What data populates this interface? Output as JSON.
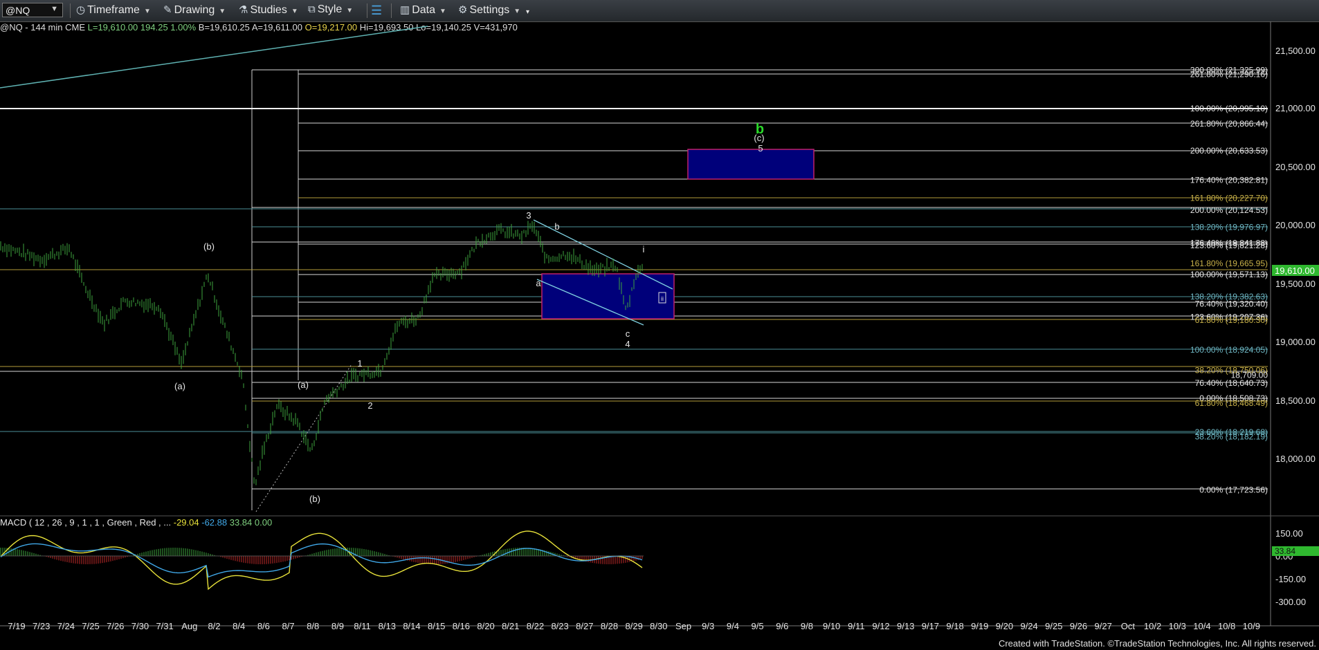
{
  "toolbar": {
    "symbol": "@NQ",
    "timeframe": "Timeframe",
    "drawing": "Drawing",
    "studies": "Studies",
    "style": "Style",
    "data": "Data",
    "settings": "Settings"
  },
  "info_bar": {
    "symbol_desc": "@NQ - 144 min  CME",
    "last": "L=19,610.00",
    "change": "194.25",
    "change_pct": "1.00%",
    "bid": "B=19,610.25",
    "ask": "A=19,611.00",
    "open": "O=19,217.00",
    "high": "Hi=19,693.50",
    "low": "Lo=19,140.25",
    "volume": "V=431,970"
  },
  "price_axis": {
    "labels": [
      "21,500.00",
      "21,000.00",
      "20,500.00",
      "20,000.00",
      "19,500.00",
      "19,000.00",
      "18,500.00",
      "18,000.00"
    ],
    "last_price_tag": "19,610.00",
    "last_price_color": "#2fb82f"
  },
  "fib_labels": [
    {
      "text": "300.00% (21,325.99)",
      "color": "#e6e6e6"
    },
    {
      "text": "261.80% (21,290.16)",
      "color": "#e6e6e6"
    },
    {
      "text": "100.00% (20,995.10)",
      "color": "#e6e6e6"
    },
    {
      "text": "261.80% (20,866.44)",
      "color": "#e6e6e6"
    },
    {
      "text": "200.00% (20,633.53)",
      "color": "#e6e6e6"
    },
    {
      "text": "176.40% (20,382.81)",
      "color": "#e6e6e6"
    },
    {
      "text": "161.80% (20,227.70)",
      "color": "#c9b24a"
    },
    {
      "text": "200.00% (20,124.53)",
      "color": "#e6e6e6"
    },
    {
      "text": "138.20% (19,976.97)",
      "color": "#6fb7c4"
    },
    {
      "text": "176.40% (19,841.88)",
      "color": "#e6e6e6"
    },
    {
      "text": "123.60% (19,821.28)",
      "color": "#e6e6e6"
    },
    {
      "text": "161.80% (19,665.95)",
      "color": "#c9b24a"
    },
    {
      "text": "100.00% (19,571.13)",
      "color": "#e6e6e6"
    },
    {
      "text": "138.20% (19,382.63)",
      "color": "#6fb7c4"
    },
    {
      "text": "76.40% (19,320.40)",
      "color": "#e6e6e6"
    },
    {
      "text": "123.60% (19,207.36)",
      "color": "#e6e6e6"
    },
    {
      "text": "61.80% (19,180.30)",
      "color": "#c9b24a"
    },
    {
      "text": "100.00% (18,924.05)",
      "color": "#6fb7c4"
    },
    {
      "text": "38.20% (18,750.06)",
      "color": "#c9b24a"
    },
    {
      "text": "18,709.00",
      "color": "#e6e6e6"
    },
    {
      "text": "76.40% (18,640.73)",
      "color": "#e6e6e6"
    },
    {
      "text": "0.00% (18,508.73)",
      "color": "#e6e6e6"
    },
    {
      "text": "61.80% (18,468.49)",
      "color": "#c9b24a"
    },
    {
      "text": "23.60% (18,219.68)",
      "color": "#6fb7c4"
    },
    {
      "text": "38.20% (18,182.19)",
      "color": "#6fb7c4"
    },
    {
      "text": "0.00% (17,723.56)",
      "color": "#e6e6e6"
    }
  ],
  "wave_labels": {
    "b_big": "b",
    "c_paren": "(c)",
    "five": "5",
    "three": "3",
    "b_small": "b",
    "a_small": "a",
    "i_small": "i",
    "c_small": "c",
    "four": "4",
    "one": "1",
    "two": "2",
    "a_paren_1": "(a)",
    "a_paren_2": "(a)",
    "b_paren_1": "(b)",
    "b_paren_2": "(b)",
    "ii_box": "ii"
  },
  "macd": {
    "title": "MACD ( 12 , 26 , 9 , 1 , 1 , Green , Red , ...",
    "macd_value": "-29.04",
    "signal_value": "-62.88",
    "hist_value": "33.84",
    "zero_value": "0.00",
    "axis_labels": [
      "150.00",
      "0.00",
      "-150.00",
      "-300.00"
    ],
    "last_tag": "33.84"
  },
  "date_axis": [
    "7/19",
    "7/23",
    "7/24",
    "7/25",
    "7/26",
    "7/30",
    "7/31",
    "Aug",
    "8/2",
    "8/4",
    "8/6",
    "8/7",
    "8/8",
    "8/9",
    "8/11",
    "8/13",
    "8/14",
    "8/15",
    "8/16",
    "8/20",
    "8/21",
    "8/22",
    "8/23",
    "8/27",
    "8/28",
    "8/29",
    "8/30",
    "Sep",
    "9/3",
    "9/4",
    "9/5",
    "9/6",
    "9/8",
    "9/10",
    "9/11",
    "9/12",
    "9/13",
    "9/17",
    "9/18",
    "9/19",
    "9/20",
    "9/24",
    "9/25",
    "9/26",
    "9/27",
    "Oct",
    "10/2",
    "10/3",
    "10/4",
    "10/8",
    "10/9"
  ],
  "footer": "Created with TradeStation. ©TradeStation Technologies, Inc. All rights reserved."
}
